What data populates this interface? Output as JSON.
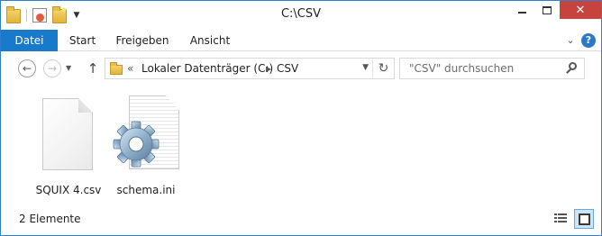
{
  "window": {
    "title": "C:\\CSV"
  },
  "quick_access": {
    "icons": [
      "folder-icon",
      "properties-icon",
      "new-folder-icon",
      "customize-dropdown-icon"
    ]
  },
  "ribbon": {
    "tabs": [
      {
        "label": "Datei"
      },
      {
        "label": "Start"
      },
      {
        "label": "Freigeben"
      },
      {
        "label": "Ansicht"
      }
    ],
    "accent": "#1979ca"
  },
  "nav": {
    "breadcrumb": {
      "overflow": "«",
      "items": [
        "Lokaler Datenträger (C:)",
        "CSV"
      ],
      "separator": "▶"
    },
    "search": {
      "placeholder": "\"CSV\" durchsuchen"
    }
  },
  "files": [
    {
      "name": "SQUIX 4.csv",
      "icon": "blank-file-icon"
    },
    {
      "name": "schema.ini",
      "icon": "settings-file-icon"
    }
  ],
  "status": {
    "count": "2 Elemente"
  },
  "colors": {
    "close_button": "#c7433d",
    "border": "#2f7fd0",
    "selected_view": "#cce4f7"
  }
}
